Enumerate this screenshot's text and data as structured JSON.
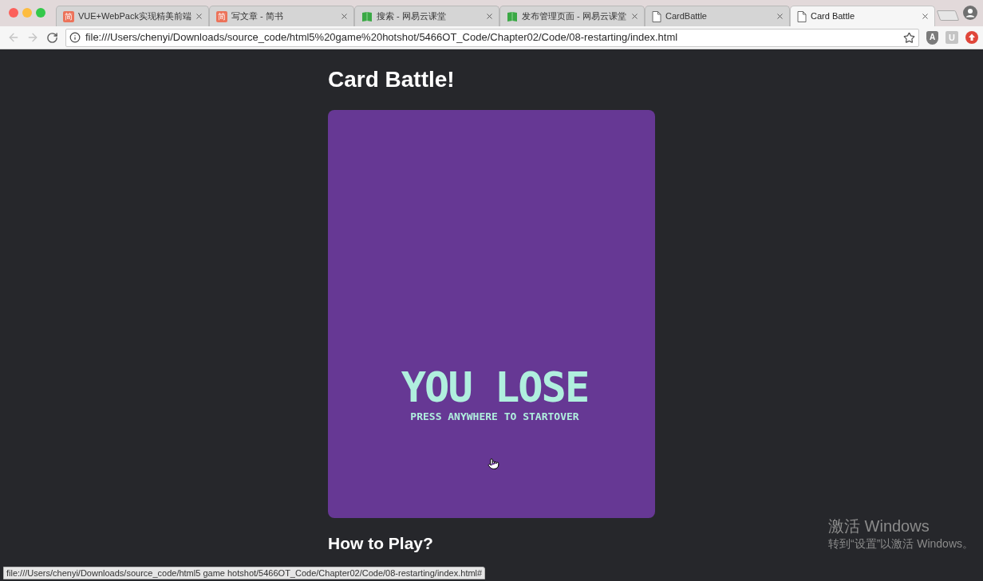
{
  "tabs": [
    {
      "title": "VUE+WebPack实现精美前端",
      "favicon": {
        "kind": "letter",
        "text": "简"
      },
      "selected": false
    },
    {
      "title": "写文章 - 简书",
      "favicon": {
        "kind": "letter",
        "text": "简"
      },
      "selected": false
    },
    {
      "title": "搜索 - 网易云课堂",
      "favicon": {
        "kind": "book"
      },
      "selected": false
    },
    {
      "title": "发布管理页面 - 网易云课堂",
      "favicon": {
        "kind": "book"
      },
      "selected": false
    },
    {
      "title": "CardBattle",
      "favicon": {
        "kind": "page"
      },
      "selected": false
    },
    {
      "title": "Card Battle",
      "favicon": {
        "kind": "page"
      },
      "selected": true
    }
  ],
  "toolbar": {
    "back": {
      "disabled": true
    },
    "forward": {
      "disabled": true
    },
    "url": "file:///Users/chenyi/Downloads/source_code/html5%20game%20hotshot/5466OT_Code/Chapter02/Code/08-restarting/index.html",
    "bookmarked": false,
    "extensions": [
      {
        "kind": "shield",
        "label": "A"
      },
      {
        "kind": "tile",
        "label": "U"
      },
      {
        "kind": "arrow_circle"
      }
    ]
  },
  "page": {
    "heading": "Card Battle!",
    "game": {
      "title": "YOU LOSE",
      "subtitle": "PRESS ANYWHERE TO STARTOVER"
    },
    "section_heading": "How to Play?"
  },
  "status_bar": {
    "link_url": "file:///Users/chenyi/Downloads/source_code/html5 game hotshot/5466OT_Code/Chapter02/Code/08-restarting/index.html#"
  },
  "os_notice": {
    "title": "激活 Windows",
    "message": "转到“设置”以激活 Windows。"
  }
}
